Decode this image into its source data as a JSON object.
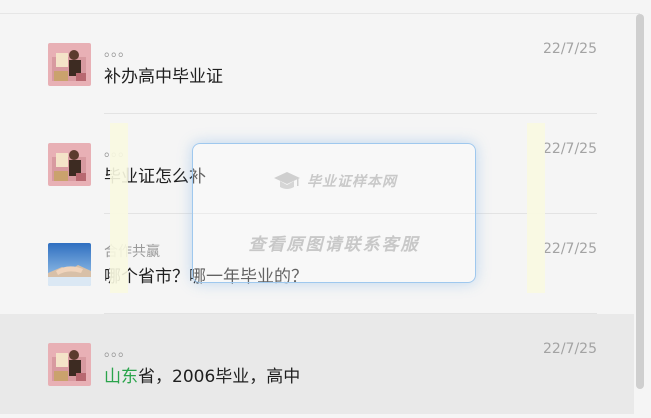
{
  "comments": [
    {
      "avatar": "certificate-photo-avatar",
      "nickname": "。。。",
      "time": "22/7/25",
      "message": "补办高中毕业证",
      "highlight": ""
    },
    {
      "avatar": "certificate-photo-avatar",
      "nickname": "。。。",
      "time": "22/7/25",
      "message": "毕业证怎么补",
      "highlight": ""
    },
    {
      "avatar": "handshake-avatar",
      "nickname": "合作共赢",
      "time": "22/7/25",
      "message": "哪个省市？哪一年毕业的？",
      "highlight": ""
    },
    {
      "avatar": "certificate-photo-avatar",
      "nickname": "。。。",
      "time": "22/7/25",
      "message": "省，2006毕业，高中",
      "highlight": "山东"
    }
  ],
  "watermark": {
    "logo_text": "毕业证样本网",
    "main_text": "查看原图请联系客服",
    "icon": "graduation-cap-icon"
  },
  "colors": {
    "highlight": "#2aa44b",
    "selected_row": "#e9e9e9",
    "watermark_border": "#9fc8ee"
  }
}
